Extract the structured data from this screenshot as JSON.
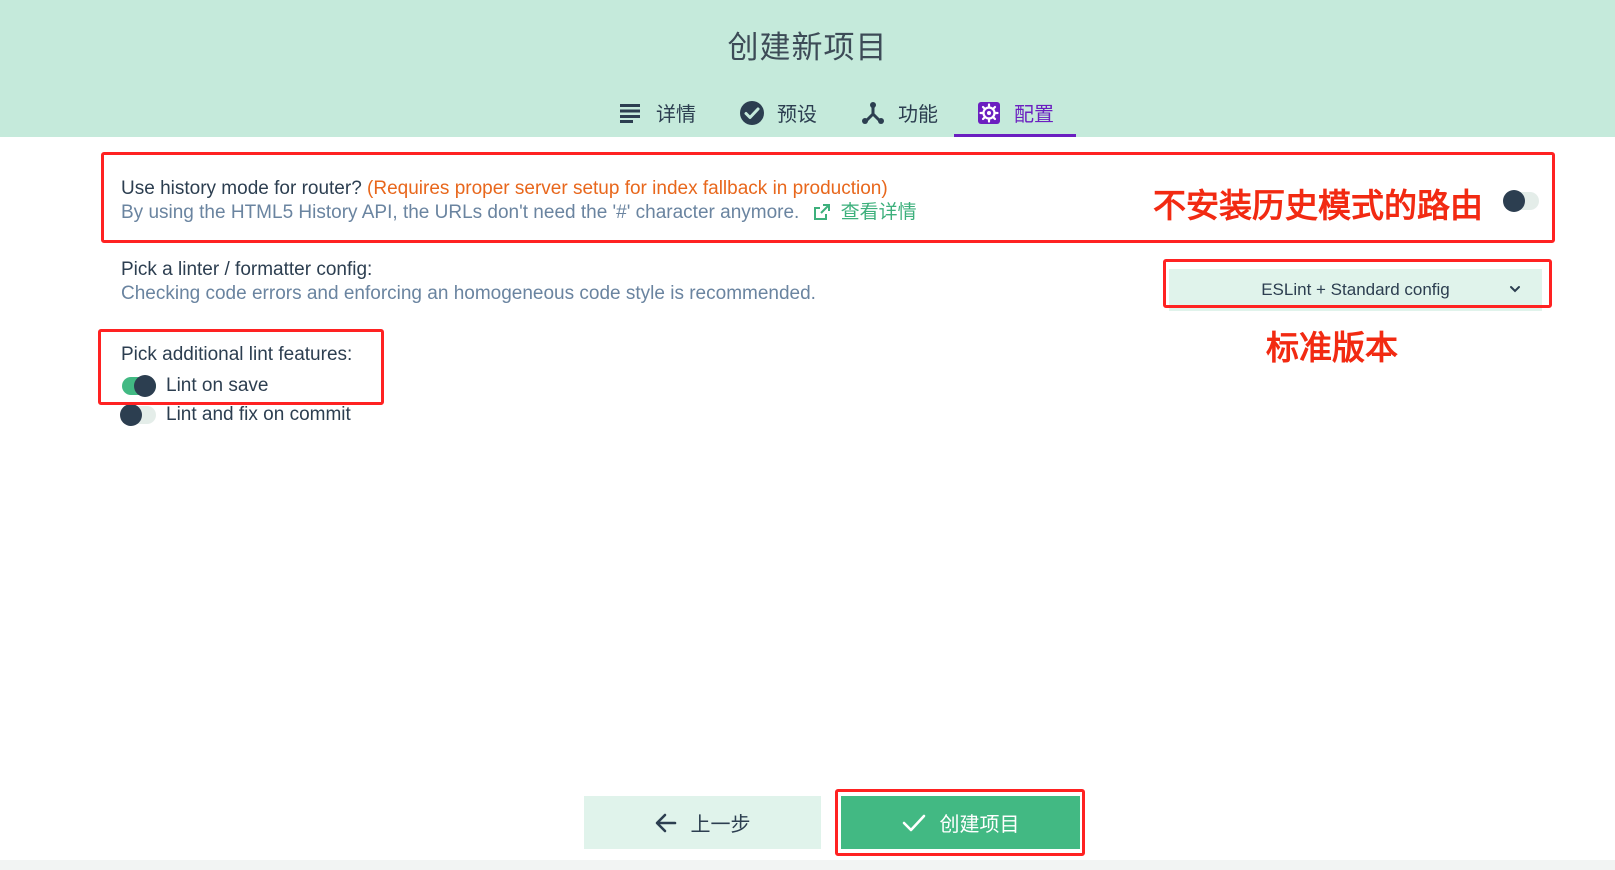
{
  "header": {
    "title": "创建新项目",
    "tabs": [
      {
        "label": "详情",
        "icon": "list-icon"
      },
      {
        "label": "预设",
        "icon": "check-circle-icon"
      },
      {
        "label": "功能",
        "icon": "fork-icon"
      },
      {
        "label": "配置",
        "icon": "gear-icon",
        "active": true
      }
    ]
  },
  "config": {
    "history": {
      "title": "Use history mode for router?",
      "warning": "(Requires proper server setup for index fallback in production)",
      "description": "By using the HTML5 History API, the URLs don't need the '#' character anymore.",
      "more_link": "查看详情",
      "enabled": false
    },
    "linter": {
      "title": "Pick a linter / formatter config:",
      "description": "Checking code errors and enforcing an homogeneous code style is recommended.",
      "selected": "ESLint + Standard config"
    },
    "lint_features": {
      "title": "Pick additional lint features:",
      "options": [
        {
          "label": "Lint on save",
          "enabled": true
        },
        {
          "label": "Lint and fix on commit",
          "enabled": false
        }
      ]
    }
  },
  "annotations": {
    "history_note": "不安装历史模式的路由",
    "linter_note": "标准版本"
  },
  "footer": {
    "prev_label": "上一步",
    "create_label": "创建项目"
  },
  "colors": {
    "header_bg": "#c5eadb",
    "accent_green": "#42b983",
    "active_tab": "#6b1fc0",
    "warning": "#e8671c",
    "annotation_red": "#ff2222"
  }
}
